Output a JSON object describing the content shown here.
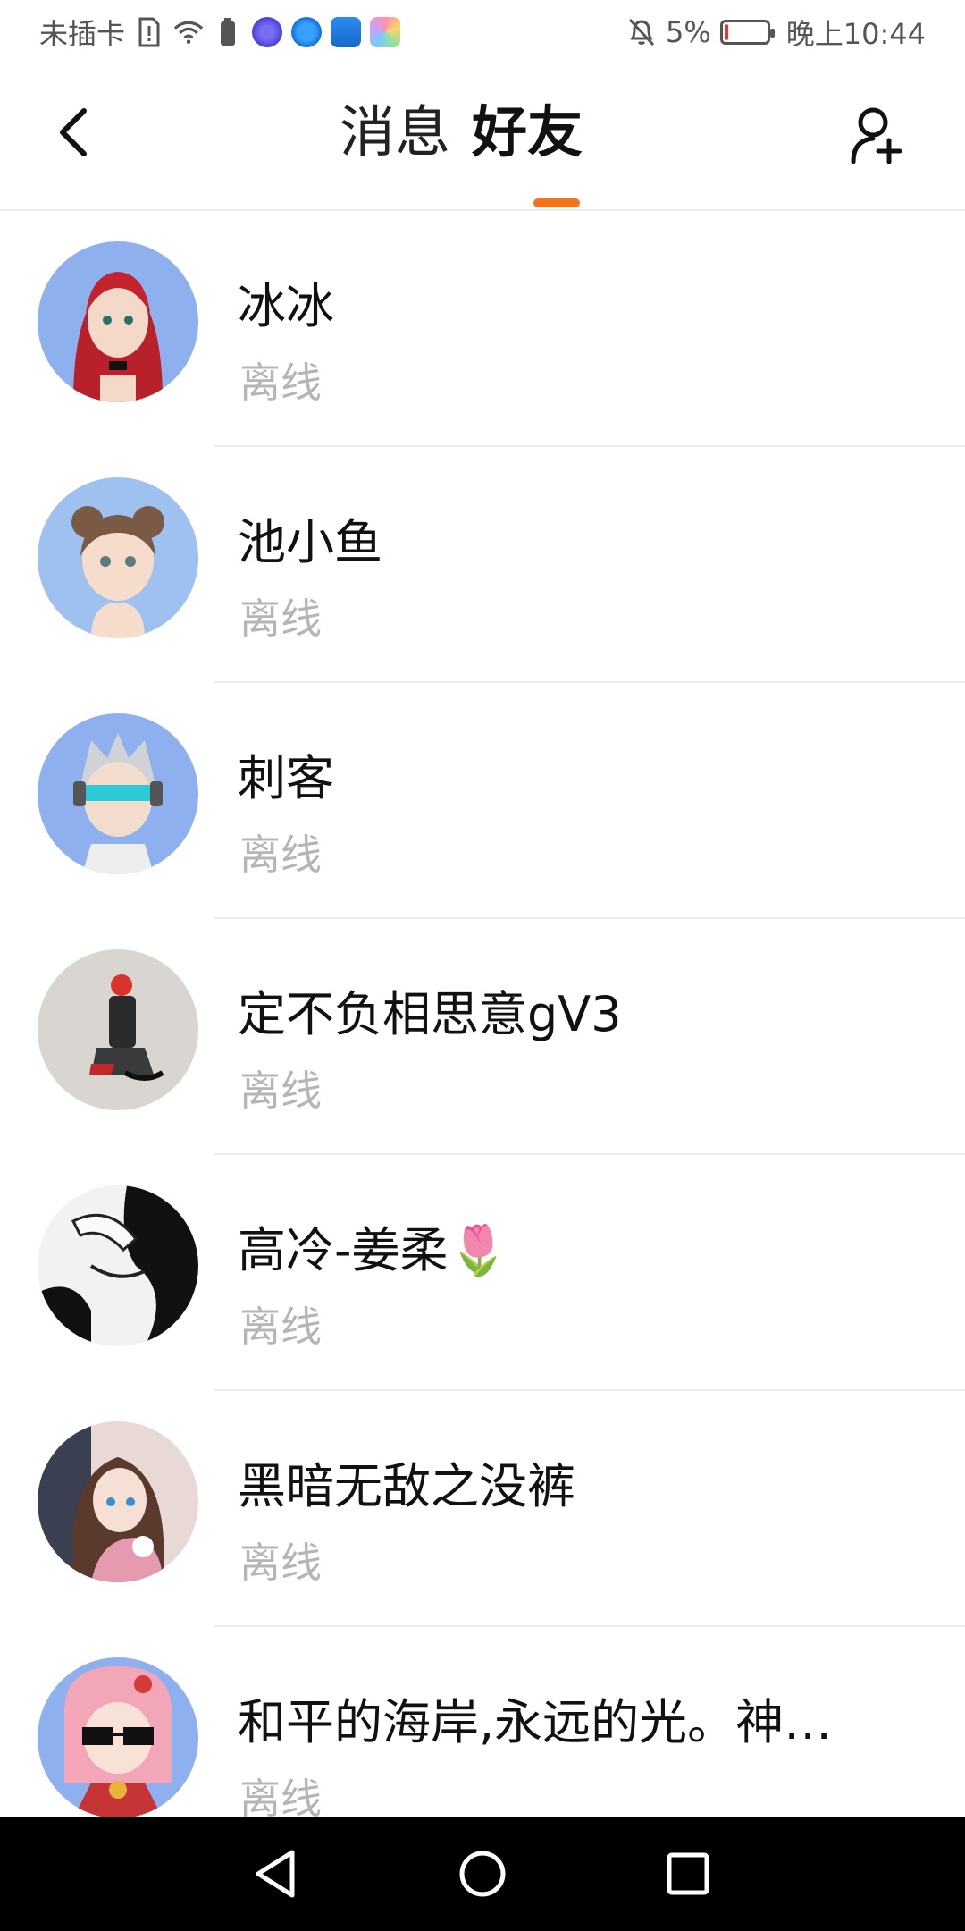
{
  "status_bar": {
    "carrier": "未插卡",
    "battery_percent": "5%",
    "time": "晚上10:44",
    "icons": [
      "sim-alert-icon",
      "wifi-icon",
      "battery-saver-icon",
      "music-app-icon",
      "browser-app-icon",
      "weather-app-icon",
      "gallery-app-icon",
      "mute-icon",
      "battery-icon"
    ]
  },
  "header": {
    "tabs": [
      {
        "label": "消息",
        "active": false
      },
      {
        "label": "好友",
        "active": true
      }
    ],
    "accent_color": "#f07522"
  },
  "friends": [
    {
      "name": "冰冰",
      "status": "离线"
    },
    {
      "name": "池小鱼",
      "status": "离线"
    },
    {
      "name": "刺客",
      "status": "离线"
    },
    {
      "name": "定不负相思意gV3",
      "status": "离线"
    },
    {
      "name": "高冷-姜柔🌷",
      "status": "离线"
    },
    {
      "name": "黑暗无敌之没裤",
      "status": "离线"
    },
    {
      "name": "和平的海岸,永远的光。神…",
      "status": "离线"
    }
  ]
}
